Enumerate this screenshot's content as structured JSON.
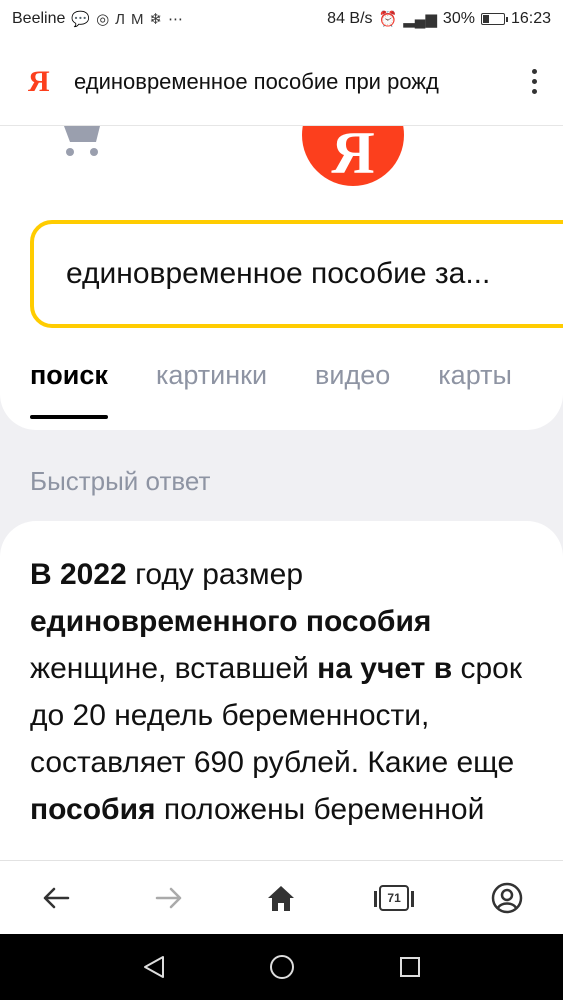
{
  "status_bar": {
    "carrier": "Beeline",
    "speed": "84 B/s",
    "battery": "30%",
    "battery_level": 0.3,
    "time": "16:23"
  },
  "address_bar": {
    "logo": "Я",
    "query": "единовременное пособие при рожд"
  },
  "header": {
    "logo_letter": "Я"
  },
  "search": {
    "query": "единовременное пособие за..."
  },
  "tabs": [
    {
      "label": "поиск",
      "active": true
    },
    {
      "label": "картинки",
      "active": false
    },
    {
      "label": "видео",
      "active": false
    },
    {
      "label": "карты",
      "active": false
    }
  ],
  "quick_answer": {
    "label": "Быстрый ответ",
    "parts": [
      {
        "text": "В 2022",
        "bold": true
      },
      {
        "text": " году размер ",
        "bold": false
      },
      {
        "text": "единовременного пособия",
        "bold": true
      },
      {
        "text": " женщине, вставшей ",
        "bold": false
      },
      {
        "text": "на учет в",
        "bold": true
      },
      {
        "text": " срок до 20 недель беременности, составляет 690 рублей. Какие еще ",
        "bold": false
      },
      {
        "text": "пособия",
        "bold": true
      },
      {
        "text": " положены беременной",
        "bold": false
      }
    ]
  },
  "bottom_nav": {
    "tabs_count": "71"
  },
  "colors": {
    "brand": "#fc3f1d",
    "search_border": "#ffcc00",
    "muted": "#8e94a3"
  }
}
